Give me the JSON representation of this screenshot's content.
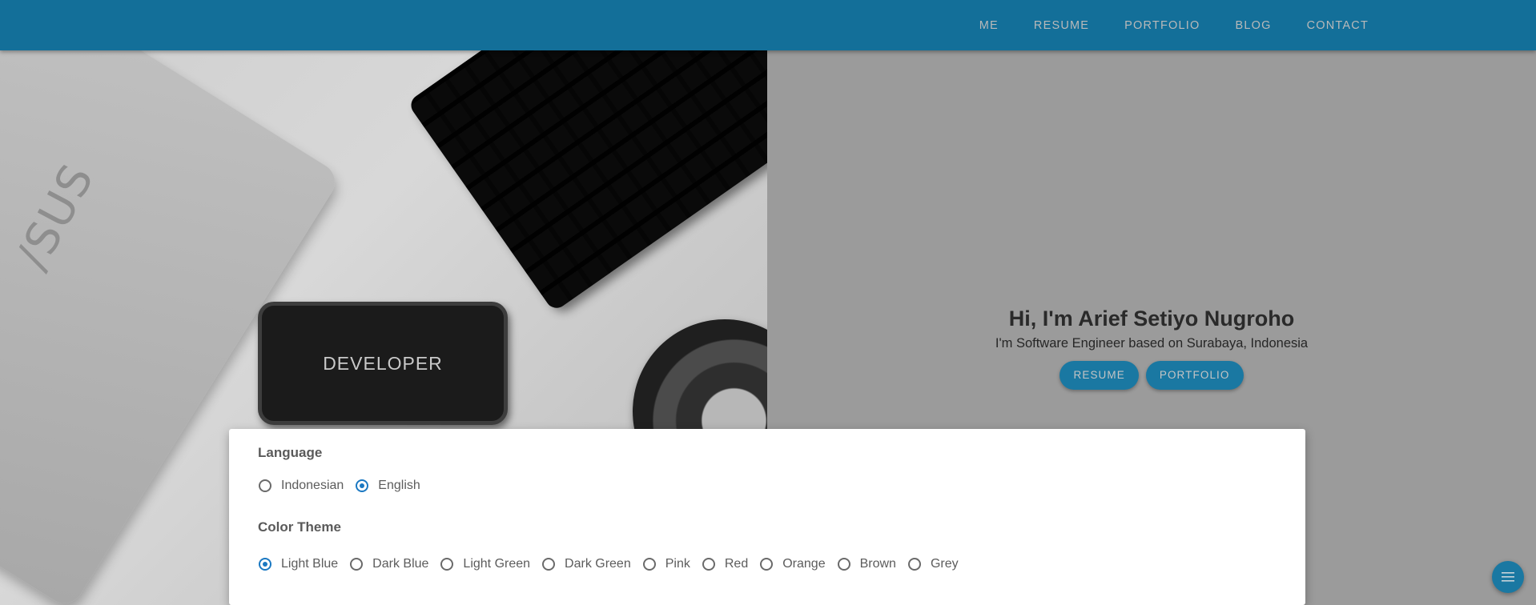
{
  "nav": {
    "items": [
      {
        "label": "ME"
      },
      {
        "label": "RESUME"
      },
      {
        "label": "PORTFOLIO"
      },
      {
        "label": "BLOG"
      },
      {
        "label": "CONTACT"
      }
    ]
  },
  "hero": {
    "photo_text": "DEVELOPER",
    "laptop_logo": "/SUS",
    "title": "Hi, I'm Arief Setiyo Nugroho",
    "subtitle": "I'm Software Engineer based on Surabaya, Indonesia",
    "buttons": {
      "resume": "RESUME",
      "portfolio": "PORTFOLIO"
    }
  },
  "settings": {
    "language": {
      "title": "Language",
      "options": [
        "Indonesian",
        "English"
      ],
      "selected": "English"
    },
    "color_theme": {
      "title": "Color Theme",
      "options": [
        "Light Blue",
        "Dark Blue",
        "Light Green",
        "Dark Green",
        "Pink",
        "Red",
        "Orange",
        "Brown",
        "Grey"
      ],
      "selected": "Light Blue"
    }
  },
  "fab": {
    "icon": "menu-icon"
  },
  "colors": {
    "primary": "#136f99",
    "accent": "#1a78c2"
  }
}
